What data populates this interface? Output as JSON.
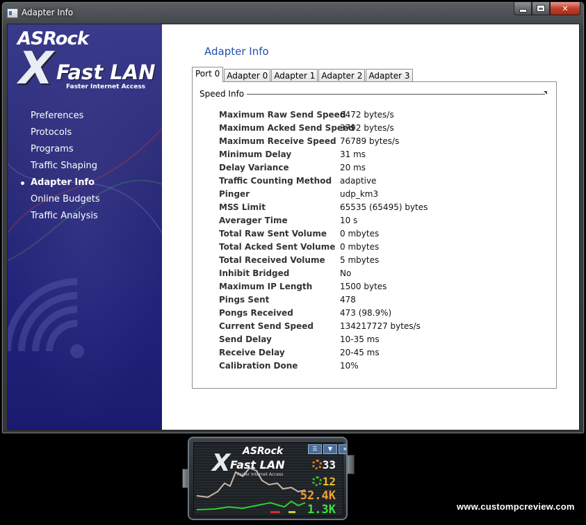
{
  "window": {
    "title": "Adapter Info",
    "controls": [
      "minimize",
      "maximize",
      "close"
    ]
  },
  "sidebar": {
    "logo": {
      "brand": "ASRock",
      "product_mark": "X",
      "product": "Fast LAN",
      "tagline": "Faster Internet Access"
    },
    "items": [
      {
        "label": "Preferences",
        "active": false
      },
      {
        "label": "Protocols",
        "active": false
      },
      {
        "label": "Programs",
        "active": false
      },
      {
        "label": "Traffic Shaping",
        "active": false
      },
      {
        "label": "Adapter Info",
        "active": true
      },
      {
        "label": "Online Budgets",
        "active": false
      },
      {
        "label": "Traffic Analysis",
        "active": false
      }
    ]
  },
  "main": {
    "title": "Adapter Info",
    "tabs": [
      {
        "label": "Port 0",
        "active": true
      },
      {
        "label": "Adapter 0",
        "active": false
      },
      {
        "label": "Adapter 1",
        "active": false
      },
      {
        "label": "Adapter 2",
        "active": false
      },
      {
        "label": "Adapter 3",
        "active": false
      }
    ],
    "group_label": "Speed Info",
    "rows": [
      {
        "key": "Maximum Raw Send Speed",
        "value": "6472 bytes/s"
      },
      {
        "key": "Maximum Acked Send Speed",
        "value": "3792 bytes/s"
      },
      {
        "key": "Maximum Receive Speed",
        "value": "76789 bytes/s"
      },
      {
        "key": "Minimum Delay",
        "value": "31 ms"
      },
      {
        "key": "Delay Variance",
        "value": "20 ms"
      },
      {
        "key": "Traffic Counting Method",
        "value": "adaptive"
      },
      {
        "key": "Pinger",
        "value": "udp_km3"
      },
      {
        "key": "MSS Limit",
        "value": "65535 (65495) bytes"
      },
      {
        "key": "Averager Time",
        "value": "10 s"
      },
      {
        "key": "Total Raw Sent Volume",
        "value": "0 mbytes"
      },
      {
        "key": "Total Acked Sent Volume",
        "value": "0 mbytes"
      },
      {
        "key": "Total Received Volume",
        "value": "5 mbytes"
      },
      {
        "key": "Inhibit Bridged",
        "value": "No"
      },
      {
        "key": "Maximum IP Length",
        "value": "1500 bytes"
      },
      {
        "key": "Pings Sent",
        "value": "478"
      },
      {
        "key": "Pongs Received",
        "value": "473 (98.9%)"
      },
      {
        "key": "Current Send Speed",
        "value": "134217727 bytes/s"
      },
      {
        "key": "Send Delay",
        "value": "10-35 ms"
      },
      {
        "key": "Receive Delay",
        "value": "20-45 ms"
      },
      {
        "key": "Calibration Done",
        "value": "10%"
      }
    ]
  },
  "gadget": {
    "brand": "ASRock",
    "product_mark": "X",
    "product": "Fast LAN",
    "tagline": "Faster Internet Access",
    "stats": [
      {
        "value": "33",
        "color": "#ffffff",
        "icon": "upload-ring-icon",
        "icon_color": "#e07a20"
      },
      {
        "value": "12",
        "color": "#e8c020",
        "icon": "download-ring-icon",
        "icon_color": "#30c030"
      },
      {
        "value": "52.4K",
        "color": "#f0a030",
        "icon": "",
        "icon_color": ""
      },
      {
        "value": "1.3K",
        "color": "#40e040",
        "icon": "",
        "icon_color": ""
      }
    ]
  },
  "watermark": "www.custompcreview.com",
  "colors": {
    "sidebar_bg": "#2a2a7e",
    "title_accent": "#1c4fb0",
    "close_button": "#c2402c"
  }
}
